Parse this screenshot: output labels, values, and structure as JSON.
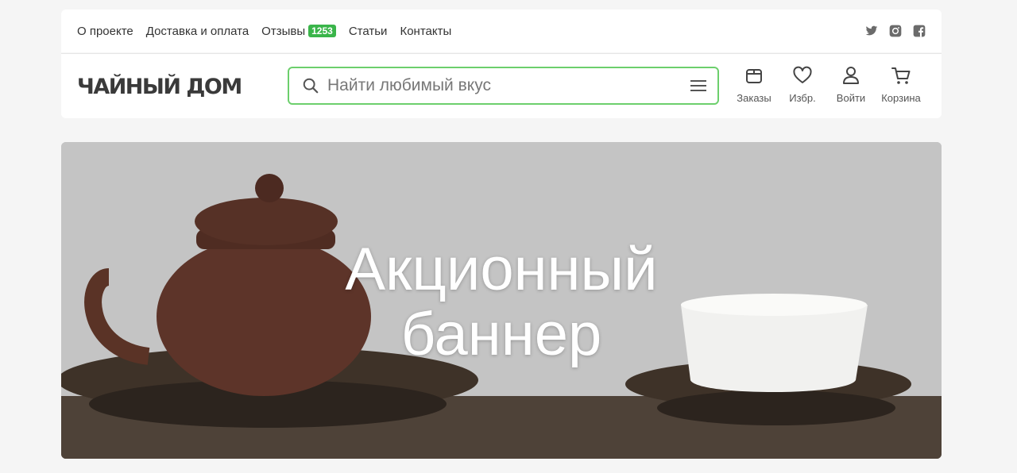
{
  "topnav": {
    "items": [
      "О проекте",
      "Доставка и оплата",
      "Отзывы",
      "Статьи",
      "Контакты"
    ],
    "reviews_count": "1253",
    "badge_color": "#3ab54a"
  },
  "socials": [
    "twitter-icon",
    "instagram-icon",
    "facebook-icon"
  ],
  "header": {
    "logo": "ЧАЙНЫЙ ДОМ",
    "search_placeholder": "Найти любимый вкус",
    "search_border_color": "#6ccf6c"
  },
  "actions": {
    "orders": "Заказы",
    "favorites": "Избр.",
    "login": "Войти",
    "cart": "Корзина"
  },
  "banner": {
    "line1": "Акционный",
    "line2": "баннер"
  }
}
